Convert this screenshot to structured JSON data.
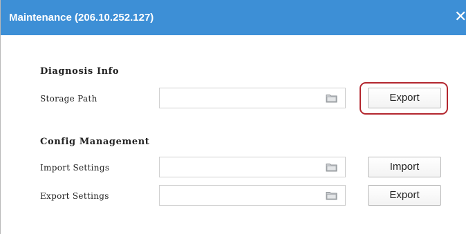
{
  "dialog": {
    "title": "Maintenance (206.10.252.127)",
    "close_glyph": "✕",
    "close_icon": "close-icon",
    "colors": {
      "titlebar": "#3d8fd6",
      "highlight": "#b3262e"
    }
  },
  "diagnosis": {
    "heading": "Diagnosis Info",
    "storage_path": {
      "label": "Storage Path",
      "value": "",
      "browse_icon": "folder-icon"
    },
    "export_button": "Export"
  },
  "config": {
    "heading": "Config Management",
    "import_settings": {
      "label": "Import Settings",
      "value": "",
      "browse_icon": "folder-icon",
      "button": "Import"
    },
    "export_settings": {
      "label": "Export Settings",
      "value": "",
      "browse_icon": "folder-icon",
      "button": "Export"
    }
  }
}
